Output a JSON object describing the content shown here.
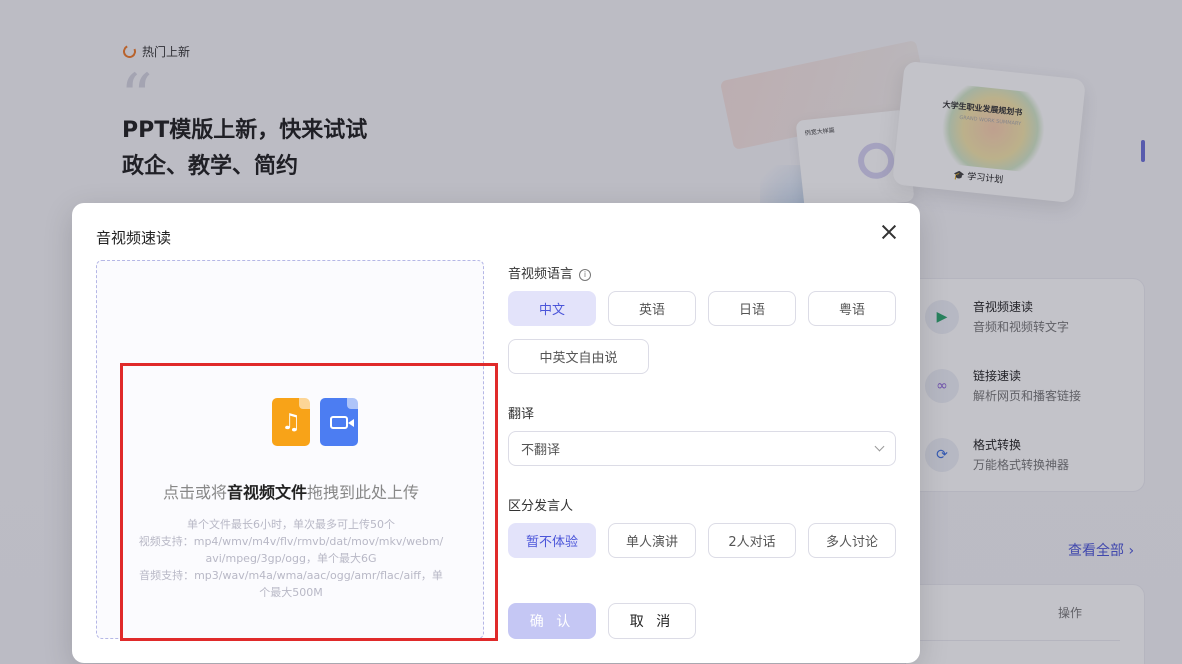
{
  "background": {
    "hot_label": "热门上新",
    "hero_title": "PPT模版上新，快来试试政企、教学、简约",
    "card_a_title": "例宽大样篇",
    "card_b_title": "大学生职业发展规划书",
    "card_b_subtitle": "GRAND WORK SUMMARY",
    "card_b_caption": "学习计划",
    "tools": [
      {
        "name": "音视频速读",
        "desc": "音频和视频转文字",
        "icon": "play-video-icon"
      },
      {
        "name": "链接速读",
        "desc": "解析网页和播客链接",
        "icon": "link-icon"
      },
      {
        "name": "格式转换",
        "desc": "万能格式转换神器",
        "icon": "convert-icon"
      }
    ],
    "view_all": "查看全部",
    "operation_header": "操作"
  },
  "modal": {
    "title": "音视频速读",
    "upload": {
      "main_prefix": "点击或将",
      "main_bold": "音视频文件",
      "main_suffix": "拖拽到此处上传",
      "hint_1": "单个文件最长6小时，单次最多可上传50个",
      "hint_2": "视频支持：mp4/wmv/m4v/flv/rmvb/dat/mov/mkv/webm/avi/mpeg/3gp/ogg，单个最大6G",
      "hint_3": "音频支持：mp3/wav/m4a/wma/aac/ogg/amr/flac/aiff，单个最大500M"
    },
    "language": {
      "label": "音视频语言",
      "options": [
        "中文",
        "英语",
        "日语",
        "粤语",
        "中英文自由说"
      ],
      "selected": "中文"
    },
    "translate": {
      "label": "翻译",
      "value": "不翻译"
    },
    "speaker": {
      "label": "区分发言人",
      "options": [
        "暂不体验",
        "单人演讲",
        "2人对话",
        "多人讨论"
      ],
      "selected": "暂不体验"
    },
    "confirm_label": "确 认",
    "cancel_label": "取 消"
  },
  "colors": {
    "accent": "#4b55d9",
    "selected_bg": "#e3e3fa",
    "highlight_border": "#e02a2a",
    "audio_icon": "#f8a318",
    "video_icon": "#4c7df2"
  }
}
